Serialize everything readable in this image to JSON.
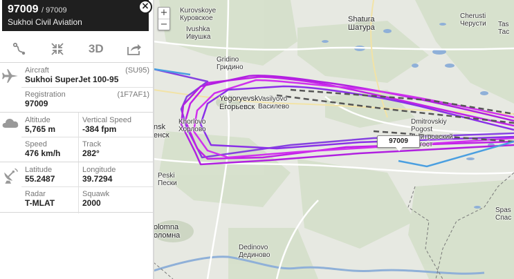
{
  "flight": {
    "callsign": "97009",
    "flight_number": "/ 97009",
    "airline": "Sukhoi Civil Aviation"
  },
  "toolbar": {
    "route_icon": "route-icon",
    "center_icon": "compress-arrows-icon",
    "view_3d_label": "3D",
    "share_icon": "share-arrow-icon"
  },
  "aircraft": {
    "label": "Aircraft",
    "code": "(SU95)",
    "value": "Sukhoi SuperJet 100-95",
    "registration_label": "Registration",
    "hex": "(1F7AF1)",
    "registration": "97009"
  },
  "flight_data": {
    "altitude_label": "Altitude",
    "altitude": "5,765 m",
    "vspeed_label": "Vertical Speed",
    "vspeed": "-384 fpm",
    "speed_label": "Speed",
    "speed": "476 km/h",
    "track_label": "Track",
    "track": "282°"
  },
  "position": {
    "lat_label": "Latitude",
    "latitude": "55.2487",
    "lon_label": "Longitude",
    "longitude": "39.7294",
    "radar_label": "Radar",
    "radar": "T-MLAT",
    "squawk_label": "Squawk",
    "squawk": "2000"
  },
  "map": {
    "zoom_in": "+",
    "zoom_out": "−",
    "aircraft_label": "97009",
    "places": {
      "kurovskoye": "Kurovskoye",
      "kurovskoye_ru": "Куровское",
      "ivushka": "Ivushka",
      "ivushka_ru": "Ивушка",
      "shatura": "Shatura",
      "shatura_ru": "Шатура",
      "cherusti": "Cherusti",
      "cherusti_ru": "Черусти",
      "gridino": "Gridino",
      "gridino_ru": "Гридино",
      "yegoryevsk": "Yegoryevsk",
      "yegoryevsk_ru": "Егорьевск",
      "vasilyovo": "Vasilyovo",
      "vasilyovo_ru": "Василево",
      "dmitrovskiy_pogost": "Dmitrovskiy",
      "dmitrovskiy_pogost2": "Pogost",
      "dmitrovskiy_ru": "Дмитровский",
      "dmitrovskiy_ru2": "Погост",
      "khorlovo": "Khorlovo",
      "khorlovo_ru": "Хорлово",
      "nsk": "nsk",
      "nsk_ru": "енск",
      "peski": "Peski",
      "peski_ru": "Пески",
      "kolomna": "olomna",
      "kolomna_ru": "оломна",
      "dedinovo": "Dedinovo",
      "dedinovo_ru": "Дединово",
      "spas": "Spas",
      "spas_ru": "Спас",
      "tas": "Tas",
      "tas_ru": "Тас"
    }
  },
  "colors": {
    "track_primary": "#c020e6",
    "track_secondary": "#7a2fe0",
    "estimated_track": "#555555",
    "approach_line": "#4a9fe0",
    "aircraft": "#e0302a",
    "header_bg": "#1f1f1f"
  }
}
